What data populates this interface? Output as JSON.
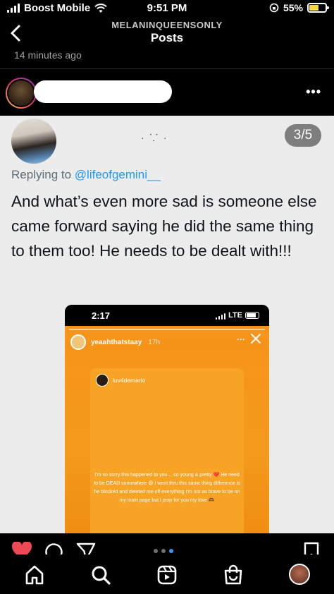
{
  "status_bar": {
    "carrier": "Boost Mobile",
    "time": "9:51 PM",
    "battery": "55%"
  },
  "header": {
    "account": "MELANINQUEENSONLY",
    "title": "Posts",
    "time_ago": "14 minutes ago"
  },
  "post": {
    "more_label": "•••"
  },
  "tweet": {
    "name_fragment": "· ⸪ ·",
    "counter": "3/5",
    "replying_prefix": "Replying to ",
    "replying_handle": "@lifeofgemini__",
    "text": "And what’s even more sad is someone else came forward saying he did the same thing to them too! He needs to be dealt with!!!"
  },
  "story": {
    "time": "2:17",
    "network": "LTE",
    "username": "yeaahthatstaay",
    "age": "17h",
    "more_label": "···",
    "inner_username": "luv4demario",
    "inner_text_1": "I’m so sorry this happened to you… so young & pretty ",
    "inner_text_2": " He need to be DEAD somewhere 😩 I went thru this same thing difference is he blocked and deleted me off everything I’m not as brave to be on my main page but I pray for you my love 🫶🏾",
    "heart": "❤️"
  },
  "carousel": {
    "pages": 3,
    "active": 2
  },
  "colors": {
    "accent": "#3897f0",
    "like": "#ed4956",
    "story_orange": "#f7931a"
  },
  "icons": [
    "back-icon",
    "more-icon",
    "heart-icon",
    "comment-icon",
    "share-icon",
    "save-icon",
    "home-icon",
    "search-icon",
    "reels-icon",
    "shop-icon"
  ]
}
